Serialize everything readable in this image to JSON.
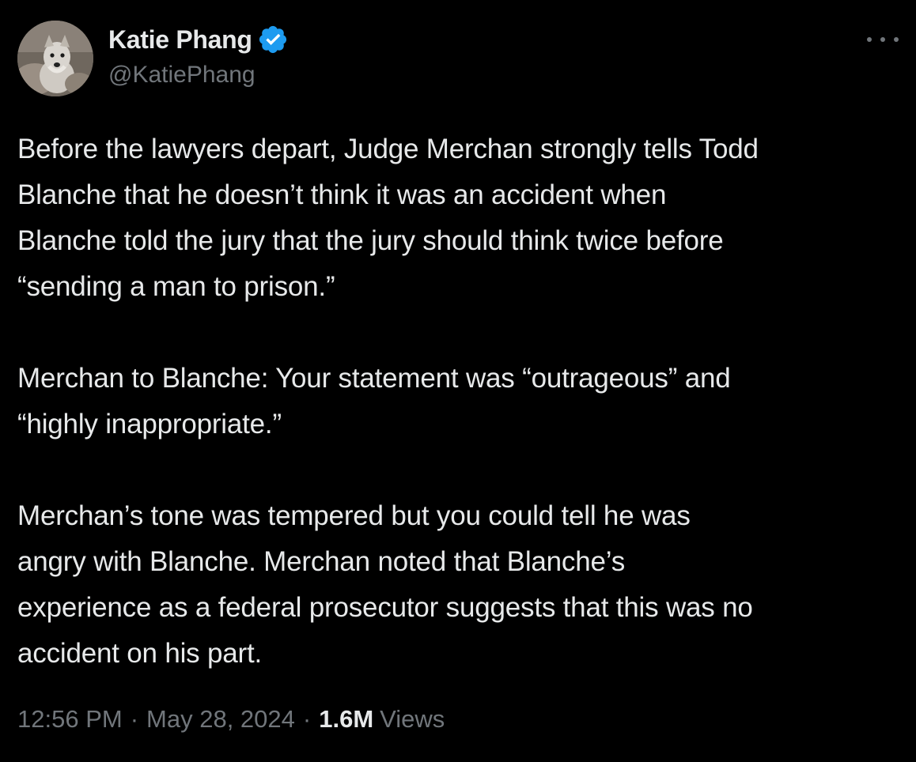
{
  "author": {
    "display_name": "Katie Phang",
    "handle": "@KatiePhang",
    "avatar_icon": "dog-avatar-icon",
    "verified": true,
    "verified_color": "#1d9bf0"
  },
  "menu": {
    "more_icon": "more-horizontal-icon"
  },
  "tweet": {
    "paragraphs": [
      {
        "lines": [
          "Before the lawyers depart, Judge Merchan strongly tells Todd",
          "Blanche that he doesn’t think it was an accident when",
          "Blanche told the jury that the jury should think twice before",
          "“sending a man to prison.”"
        ]
      },
      {
        "lines": [
          "Merchan to Blanche: Your statement was “outrageous” and",
          "“highly inappropriate.”"
        ]
      },
      {
        "lines": [
          "Merchan’s tone was tempered but you could tell he was",
          "angry with Blanche. Merchan noted that Blanche’s",
          "experience as a federal prosecutor suggests that this was no",
          "accident on his part."
        ]
      }
    ]
  },
  "meta": {
    "time": "12:56 PM",
    "separator": "·",
    "date": "May 28, 2024",
    "views_count": "1.6M",
    "views_label": "Views"
  },
  "colors": {
    "background": "#000000",
    "primary_text": "#e7e9ea",
    "secondary_text": "#71767b",
    "accent": "#1d9bf0"
  }
}
